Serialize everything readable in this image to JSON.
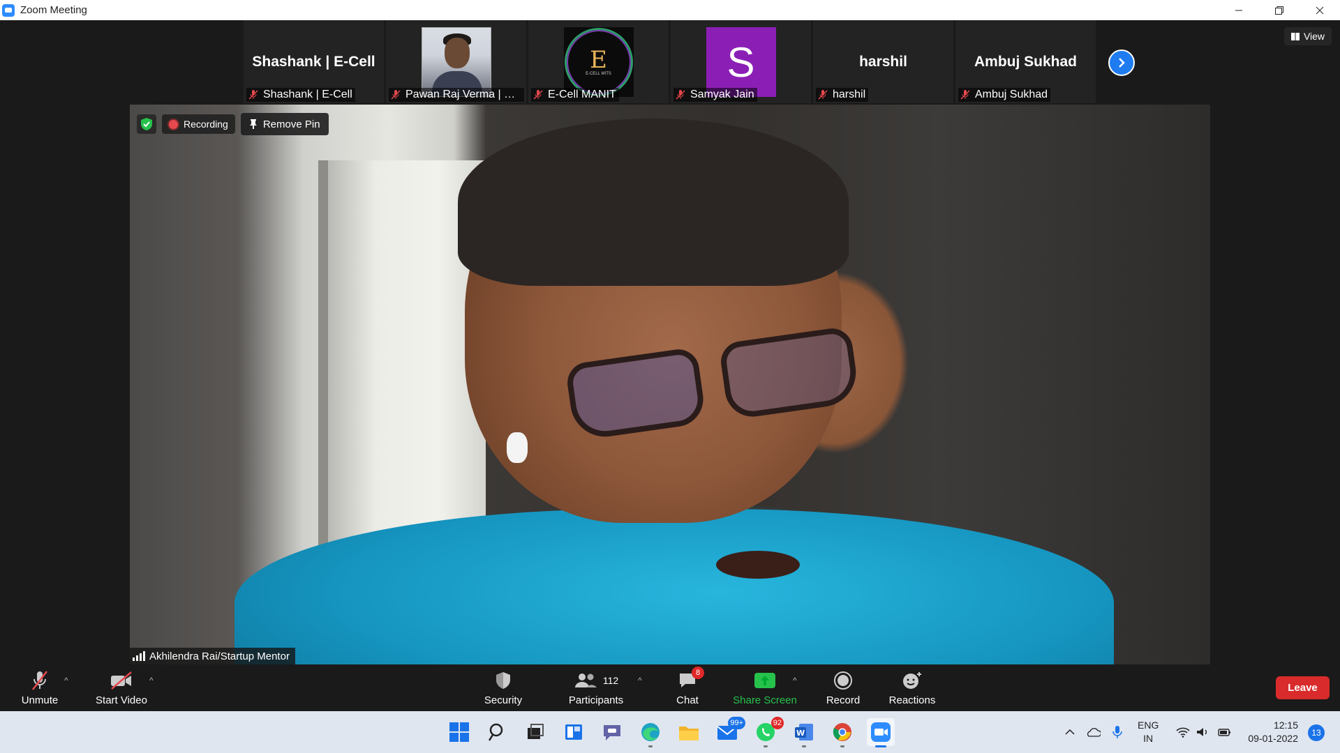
{
  "window": {
    "title": "Zoom Meeting",
    "controls": [
      "minimize-icon",
      "restore-icon",
      "close-icon"
    ]
  },
  "participants_strip": [
    {
      "display": "Shashank | E-Cell",
      "label": "Shashank | E-Cell",
      "avatar": "name-text",
      "muted": true
    },
    {
      "display": "",
      "label": "Pawan Raj Verma | E-C...",
      "avatar": "photo",
      "muted": true
    },
    {
      "display": "",
      "label": "E-Cell MANIT",
      "avatar": "ecell-logo",
      "muted": true
    },
    {
      "display": "S",
      "label": "Samyak Jain",
      "avatar": "letter",
      "avatar_color": "#8b1fb5",
      "muted": true
    },
    {
      "display": "harshil",
      "label": "harshil",
      "avatar": "name-text",
      "muted": true
    },
    {
      "display": "Ambuj Sukhad",
      "label": "Ambuj Sukhad",
      "avatar": "name-text",
      "muted": true
    }
  ],
  "ecell_logo": {
    "letter": "E",
    "small": "E-CELL MITS"
  },
  "view_button": {
    "label": "View"
  },
  "main_video": {
    "recording_label": "Recording",
    "pin_label": "Remove Pin",
    "speaker_name": "Akhilendra Rai/Startup Mentor"
  },
  "toolbar": {
    "unmute": "Unmute",
    "start_video": "Start Video",
    "security": "Security",
    "participants": "Participants",
    "participants_count": "112",
    "chat": "Chat",
    "chat_badge": "8",
    "share_screen": "Share Screen",
    "record": "Record",
    "reactions": "Reactions",
    "leave": "Leave"
  },
  "taskbar": {
    "mail_badge": "99+",
    "whatsapp_badge": "92",
    "language_top": "ENG",
    "language_bottom": "IN",
    "time": "12:15",
    "date": "09-01-2022",
    "notifications": "13"
  },
  "colors": {
    "accent": "#2d8cff",
    "leave": "#d92b2b",
    "share": "#27c24c",
    "recording": "#e5484d"
  }
}
